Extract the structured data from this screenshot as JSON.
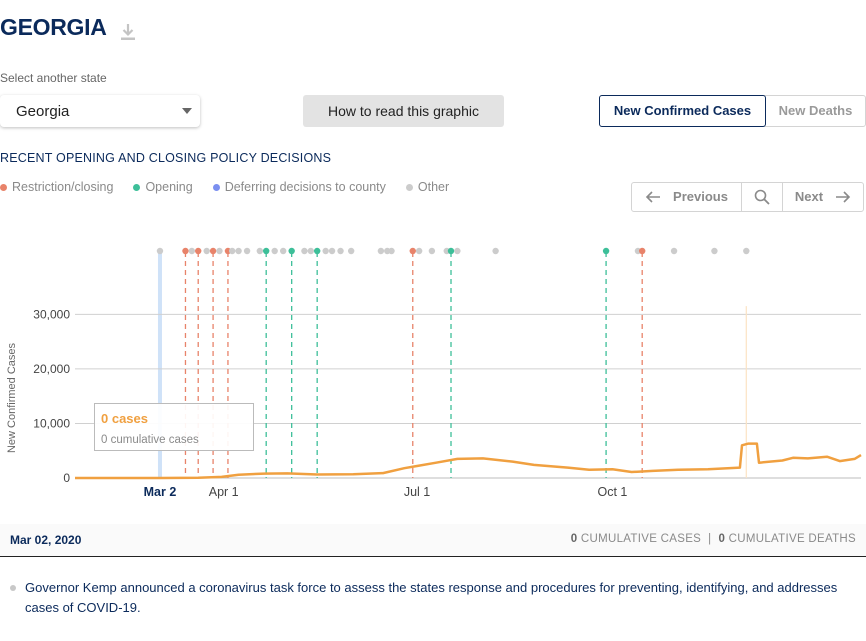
{
  "header": {
    "state_title": "GEORGIA",
    "download_icon": "download-icon"
  },
  "state_select": {
    "label": "Select another state",
    "value": "Georgia"
  },
  "how_button": {
    "label": "How to read this graphic"
  },
  "metric_toggle": {
    "cases_label": "New Confirmed Cases",
    "deaths_label": "New Deaths",
    "selected": "cases"
  },
  "policy": {
    "heading": "RECENT OPENING AND CLOSING POLICY DECISIONS",
    "legend": [
      {
        "label": "Restriction/closing",
        "color": "#e8836a"
      },
      {
        "label": "Opening",
        "color": "#3dbf99"
      },
      {
        "label": "Deferring decisions to county",
        "color": "#7b8ff0"
      },
      {
        "label": "Other",
        "color": "#cccccc"
      }
    ]
  },
  "pager": {
    "prev_label": "Previous",
    "next_label": "Next",
    "prev_icon": "arrow-left-icon",
    "search_icon": "search-icon",
    "next_icon": "arrow-right-icon"
  },
  "colors": {
    "navy": "#0b2a5b",
    "line": "#f0a040",
    "restriction": "#e8836a",
    "opening": "#3dbf99",
    "other": "#cccccc",
    "highlight": "#cfe2f8"
  },
  "chart_data": {
    "type": "line",
    "ylabel": "New Confirmed Cases",
    "y_ticks": [
      {
        "value": 0,
        "label": "0"
      },
      {
        "value": 10000,
        "label": "10,000"
      },
      {
        "value": 20000,
        "label": "20,000"
      },
      {
        "value": 30000,
        "label": "30,000"
      }
    ],
    "ylim": [
      0,
      33000
    ],
    "grid": true,
    "x_ticks": [
      {
        "date": "2020-03-02",
        "label": "Mar 2",
        "highlight": true
      },
      {
        "date": "2020-04-01",
        "label": "Apr 1"
      },
      {
        "date": "2020-07-01",
        "label": "Jul 1"
      },
      {
        "date": "2020-10-01",
        "label": "Oct 1"
      }
    ],
    "xlim": [
      "2020-01-22",
      "2021-01-26"
    ],
    "highlight_date": "2020-03-02",
    "series": [
      {
        "points": [
          [
            "2020-01-22",
            0
          ],
          [
            "2020-03-02",
            0
          ],
          [
            "2020-03-20",
            50
          ],
          [
            "2020-03-31",
            200
          ],
          [
            "2020-04-08",
            600
          ],
          [
            "2020-04-20",
            800
          ],
          [
            "2020-05-01",
            850
          ],
          [
            "2020-05-15",
            650
          ],
          [
            "2020-06-01",
            700
          ],
          [
            "2020-06-15",
            900
          ],
          [
            "2020-06-25",
            1800
          ],
          [
            "2020-07-01",
            2200
          ],
          [
            "2020-07-10",
            2800
          ],
          [
            "2020-07-20",
            3500
          ],
          [
            "2020-08-01",
            3600
          ],
          [
            "2020-08-15",
            3000
          ],
          [
            "2020-08-25",
            2400
          ],
          [
            "2020-09-10",
            1900
          ],
          [
            "2020-09-20",
            1500
          ],
          [
            "2020-10-01",
            1600
          ],
          [
            "2020-10-10",
            1100
          ],
          [
            "2020-10-20",
            1300
          ],
          [
            "2020-11-01",
            1500
          ],
          [
            "2020-11-15",
            1600
          ],
          [
            "2020-11-30",
            1900
          ],
          [
            "2020-12-01",
            6000
          ],
          [
            "2020-12-04",
            6300
          ],
          [
            "2020-12-08",
            6300
          ],
          [
            "2020-12-09",
            2800
          ],
          [
            "2020-12-20",
            3200
          ],
          [
            "2020-12-25",
            3700
          ],
          [
            "2021-01-01",
            3600
          ],
          [
            "2021-01-10",
            3900
          ],
          [
            "2021-01-16",
            3100
          ],
          [
            "2021-01-23",
            3500
          ],
          [
            "2021-01-26",
            4200
          ]
        ],
        "color": "#f0a040"
      }
    ],
    "policy_events": [
      {
        "date": "2020-03-02",
        "type": "other"
      },
      {
        "date": "2020-03-14",
        "type": "restriction"
      },
      {
        "date": "2020-03-17",
        "type": "other"
      },
      {
        "date": "2020-03-20",
        "type": "restriction"
      },
      {
        "date": "2020-03-24",
        "type": "other"
      },
      {
        "date": "2020-03-27",
        "type": "restriction"
      },
      {
        "date": "2020-03-30",
        "type": "other"
      },
      {
        "date": "2020-04-03",
        "type": "restriction"
      },
      {
        "date": "2020-04-05",
        "type": "other"
      },
      {
        "date": "2020-04-08",
        "type": "other"
      },
      {
        "date": "2020-04-12",
        "type": "other"
      },
      {
        "date": "2020-04-18",
        "type": "other"
      },
      {
        "date": "2020-04-21",
        "type": "opening"
      },
      {
        "date": "2020-04-25",
        "type": "other"
      },
      {
        "date": "2020-04-29",
        "type": "other"
      },
      {
        "date": "2020-05-03",
        "type": "opening"
      },
      {
        "date": "2020-05-09",
        "type": "other"
      },
      {
        "date": "2020-05-12",
        "type": "other"
      },
      {
        "date": "2020-05-15",
        "type": "opening"
      },
      {
        "date": "2020-05-19",
        "type": "other"
      },
      {
        "date": "2020-05-22",
        "type": "other"
      },
      {
        "date": "2020-05-26",
        "type": "other"
      },
      {
        "date": "2020-05-31",
        "type": "other"
      },
      {
        "date": "2020-06-14",
        "type": "other"
      },
      {
        "date": "2020-06-17",
        "type": "other"
      },
      {
        "date": "2020-06-19",
        "type": "other"
      },
      {
        "date": "2020-06-29",
        "type": "restriction"
      },
      {
        "date": "2020-07-02",
        "type": "other"
      },
      {
        "date": "2020-07-08",
        "type": "other"
      },
      {
        "date": "2020-07-15",
        "type": "other"
      },
      {
        "date": "2020-07-17",
        "type": "opening"
      },
      {
        "date": "2020-07-20",
        "type": "other"
      },
      {
        "date": "2020-08-07",
        "type": "other"
      },
      {
        "date": "2020-09-28",
        "type": "opening"
      },
      {
        "date": "2020-10-13",
        "type": "other"
      },
      {
        "date": "2020-10-15",
        "type": "restriction"
      },
      {
        "date": "2020-10-30",
        "type": "other"
      },
      {
        "date": "2020-11-18",
        "type": "other"
      },
      {
        "date": "2020-12-03",
        "type": "other"
      }
    ]
  },
  "tooltip": {
    "cases": "0 cases",
    "cumulative": "0 cumulative cases"
  },
  "date_bar": {
    "date": "Mar 02, 2020",
    "cum_cases_value": "0",
    "cum_cases_label": "CUMULATIVE CASES",
    "separator": "|",
    "cum_deaths_value": "0",
    "cum_deaths_label": "CUMULATIVE DEATHS"
  },
  "event": {
    "text": "Governor Kemp announced a coronavirus task force to assess the states response and procedures for preventing, identifying, and addresses cases of COVID-19."
  }
}
